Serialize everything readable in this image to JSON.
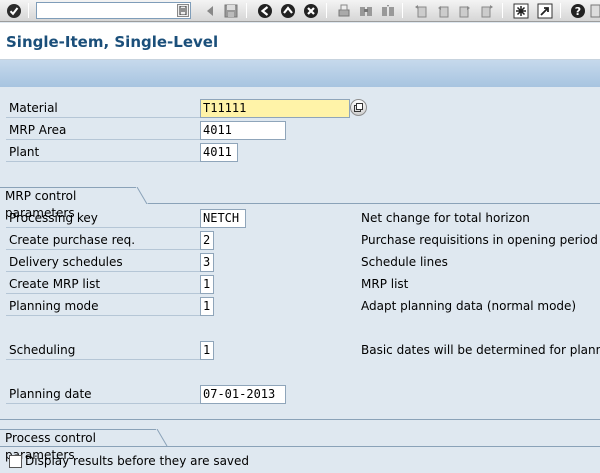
{
  "toolbar": {
    "command_field_value": "",
    "icons": [
      "enter-icon",
      "command-history-icon",
      "save-icon",
      "back-icon",
      "exit-icon",
      "cancel-icon",
      "print-icon",
      "find-icon",
      "find-next-icon",
      "first-page-icon",
      "previous-page-icon",
      "next-page-icon",
      "last-page-icon",
      "new-session-icon",
      "shortcut-icon",
      "help-icon"
    ]
  },
  "title": "Single-Item, Single-Level",
  "header_fields": [
    {
      "label": "Material",
      "value": "T11111",
      "required": true
    },
    {
      "label": "MRP Area",
      "value": "4011",
      "required": false
    },
    {
      "label": "Plant",
      "value": "4011",
      "required": false
    }
  ],
  "mrp_group": {
    "title": "MRP control parameters",
    "fields": [
      {
        "label": "Processing key",
        "value": "NETCH",
        "description": "Net change for total horizon"
      },
      {
        "label": "Create purchase req.",
        "value": "2",
        "description": "Purchase requisitions in opening period"
      },
      {
        "label": "Delivery schedules",
        "value": "3",
        "description": "Schedule lines"
      },
      {
        "label": "Create MRP list",
        "value": "1",
        "description": "MRP list"
      },
      {
        "label": "Planning mode",
        "value": "1",
        "description": "Adapt planning data (normal mode)"
      },
      {
        "label": "Scheduling",
        "value": "1",
        "description": "Basic dates will be determined for plann"
      },
      {
        "label": "Planning date",
        "value": "07-01-2013",
        "description": ""
      }
    ]
  },
  "process_group": {
    "title": "Process control parameters",
    "checkbox_label": "Display results before they are saved",
    "checkbox_checked": false
  },
  "colors": {
    "title_text": "#1b4f7a",
    "app_toolbar": "#a7c4e0",
    "background": "#dfe8f0",
    "required_field": "#fff3a8"
  }
}
